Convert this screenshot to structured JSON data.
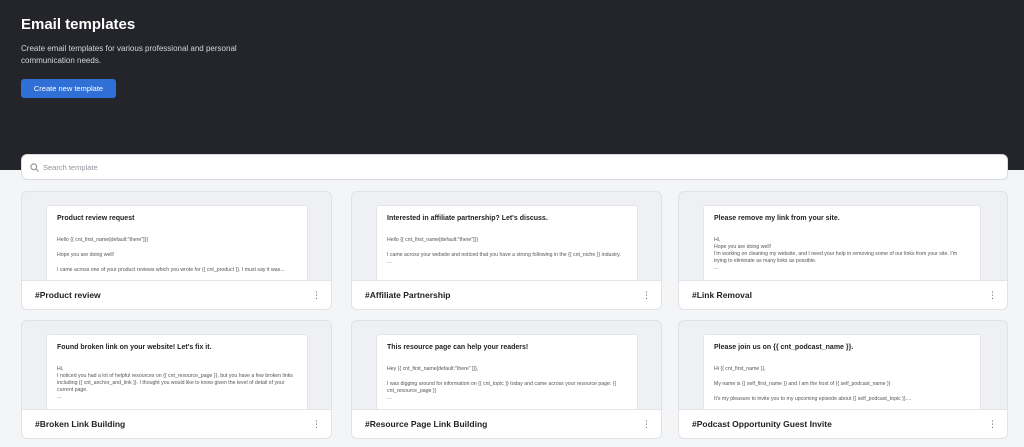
{
  "header": {
    "title": "Email templates",
    "description": "Create email templates for various professional and personal communication needs.",
    "create_button": "Create new template"
  },
  "search": {
    "placeholder": "Search template",
    "value": ""
  },
  "templates": [
    {
      "name": "#Product review",
      "subject": "Product review request",
      "lines": [
        "Hello {{ cnt_first_name[default:\"there\"]}}",
        "Hope you are doing well!",
        "I came across one of your product reviews which you wrote for {{ cnt_product }}. I must say it was..."
      ]
    },
    {
      "name": "#Affiliate Partnership",
      "subject": "Interested in affiliate partnership? Let's discuss.",
      "lines": [
        "Hello {{ cnt_first_name[default:\"there\"]}}",
        "I came across your website and noticed that you have a strong following in the {{ cnt_niche }} industry.",
        "..."
      ]
    },
    {
      "name": "#Link Removal",
      "subject": "Please remove my link from your site.",
      "lines": [
        "Hi,",
        "Hope you are doing well!",
        "I'm working on cleaning my website, and I need your help in removing some of our links from your site. I'm trying to eliminate as many links as possible.",
        "..."
      ]
    },
    {
      "name": "#Broken Link Building",
      "subject": "Found broken link on your website! Let's fix it.",
      "lines": [
        "Hi,",
        "I noticed you had a lot of helpful resources on {{ cnt_resource_page }}, but you have a few broken links including {{ cnt_anchor_and_link }}. I thought you would like to know given the level of detail of your current page.",
        "..."
      ]
    },
    {
      "name": "#Resource Page Link Building",
      "subject": "This resource page can help your readers!",
      "lines": [
        "Hey {{ cnt_first_name[default:\"there\" ]}},",
        "I was digging around for information on {{ cnt_topic }} today and came across your resource page: {{ cnt_resource_page }}",
        "..."
      ]
    },
    {
      "name": "#Podcast Opportunity Guest Invite",
      "subject": "Please join us on {{ cnt_podcast_name }}.",
      "lines": [
        "Hi {{ cnt_first_name }},",
        "My name is {{ self_first_name }} and I am the host of {{ self_podcast_name }}",
        "It's my pleasure to invite you to my upcoming episode about {{ self_podcast_topic }}...."
      ]
    }
  ],
  "card_menu_glyph": "⋮",
  "colors": {
    "hero_bg": "#24252b",
    "primary_button": "#2f6fd6"
  }
}
